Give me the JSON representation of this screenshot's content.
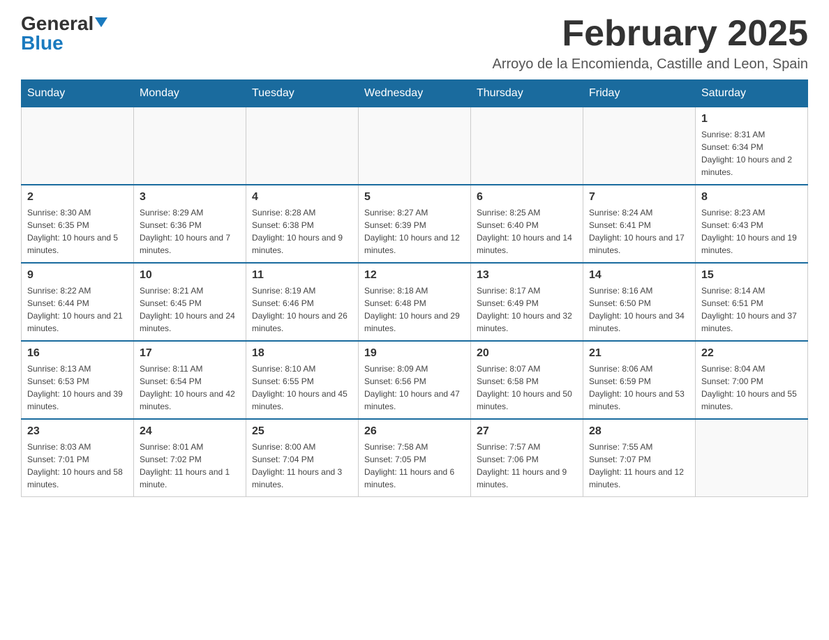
{
  "logo": {
    "text_general": "General",
    "text_blue": "Blue"
  },
  "calendar": {
    "title": "February 2025",
    "subtitle": "Arroyo de la Encomienda, Castille and Leon, Spain",
    "days_of_week": [
      "Sunday",
      "Monday",
      "Tuesday",
      "Wednesday",
      "Thursday",
      "Friday",
      "Saturday"
    ],
    "weeks": [
      [
        {
          "day": "",
          "info": ""
        },
        {
          "day": "",
          "info": ""
        },
        {
          "day": "",
          "info": ""
        },
        {
          "day": "",
          "info": ""
        },
        {
          "day": "",
          "info": ""
        },
        {
          "day": "",
          "info": ""
        },
        {
          "day": "1",
          "info": "Sunrise: 8:31 AM\nSunset: 6:34 PM\nDaylight: 10 hours and 2 minutes."
        }
      ],
      [
        {
          "day": "2",
          "info": "Sunrise: 8:30 AM\nSunset: 6:35 PM\nDaylight: 10 hours and 5 minutes."
        },
        {
          "day": "3",
          "info": "Sunrise: 8:29 AM\nSunset: 6:36 PM\nDaylight: 10 hours and 7 minutes."
        },
        {
          "day": "4",
          "info": "Sunrise: 8:28 AM\nSunset: 6:38 PM\nDaylight: 10 hours and 9 minutes."
        },
        {
          "day": "5",
          "info": "Sunrise: 8:27 AM\nSunset: 6:39 PM\nDaylight: 10 hours and 12 minutes."
        },
        {
          "day": "6",
          "info": "Sunrise: 8:25 AM\nSunset: 6:40 PM\nDaylight: 10 hours and 14 minutes."
        },
        {
          "day": "7",
          "info": "Sunrise: 8:24 AM\nSunset: 6:41 PM\nDaylight: 10 hours and 17 minutes."
        },
        {
          "day": "8",
          "info": "Sunrise: 8:23 AM\nSunset: 6:43 PM\nDaylight: 10 hours and 19 minutes."
        }
      ],
      [
        {
          "day": "9",
          "info": "Sunrise: 8:22 AM\nSunset: 6:44 PM\nDaylight: 10 hours and 21 minutes."
        },
        {
          "day": "10",
          "info": "Sunrise: 8:21 AM\nSunset: 6:45 PM\nDaylight: 10 hours and 24 minutes."
        },
        {
          "day": "11",
          "info": "Sunrise: 8:19 AM\nSunset: 6:46 PM\nDaylight: 10 hours and 26 minutes."
        },
        {
          "day": "12",
          "info": "Sunrise: 8:18 AM\nSunset: 6:48 PM\nDaylight: 10 hours and 29 minutes."
        },
        {
          "day": "13",
          "info": "Sunrise: 8:17 AM\nSunset: 6:49 PM\nDaylight: 10 hours and 32 minutes."
        },
        {
          "day": "14",
          "info": "Sunrise: 8:16 AM\nSunset: 6:50 PM\nDaylight: 10 hours and 34 minutes."
        },
        {
          "day": "15",
          "info": "Sunrise: 8:14 AM\nSunset: 6:51 PM\nDaylight: 10 hours and 37 minutes."
        }
      ],
      [
        {
          "day": "16",
          "info": "Sunrise: 8:13 AM\nSunset: 6:53 PM\nDaylight: 10 hours and 39 minutes."
        },
        {
          "day": "17",
          "info": "Sunrise: 8:11 AM\nSunset: 6:54 PM\nDaylight: 10 hours and 42 minutes."
        },
        {
          "day": "18",
          "info": "Sunrise: 8:10 AM\nSunset: 6:55 PM\nDaylight: 10 hours and 45 minutes."
        },
        {
          "day": "19",
          "info": "Sunrise: 8:09 AM\nSunset: 6:56 PM\nDaylight: 10 hours and 47 minutes."
        },
        {
          "day": "20",
          "info": "Sunrise: 8:07 AM\nSunset: 6:58 PM\nDaylight: 10 hours and 50 minutes."
        },
        {
          "day": "21",
          "info": "Sunrise: 8:06 AM\nSunset: 6:59 PM\nDaylight: 10 hours and 53 minutes."
        },
        {
          "day": "22",
          "info": "Sunrise: 8:04 AM\nSunset: 7:00 PM\nDaylight: 10 hours and 55 minutes."
        }
      ],
      [
        {
          "day": "23",
          "info": "Sunrise: 8:03 AM\nSunset: 7:01 PM\nDaylight: 10 hours and 58 minutes."
        },
        {
          "day": "24",
          "info": "Sunrise: 8:01 AM\nSunset: 7:02 PM\nDaylight: 11 hours and 1 minute."
        },
        {
          "day": "25",
          "info": "Sunrise: 8:00 AM\nSunset: 7:04 PM\nDaylight: 11 hours and 3 minutes."
        },
        {
          "day": "26",
          "info": "Sunrise: 7:58 AM\nSunset: 7:05 PM\nDaylight: 11 hours and 6 minutes."
        },
        {
          "day": "27",
          "info": "Sunrise: 7:57 AM\nSunset: 7:06 PM\nDaylight: 11 hours and 9 minutes."
        },
        {
          "day": "28",
          "info": "Sunrise: 7:55 AM\nSunset: 7:07 PM\nDaylight: 11 hours and 12 minutes."
        },
        {
          "day": "",
          "info": ""
        }
      ]
    ]
  }
}
